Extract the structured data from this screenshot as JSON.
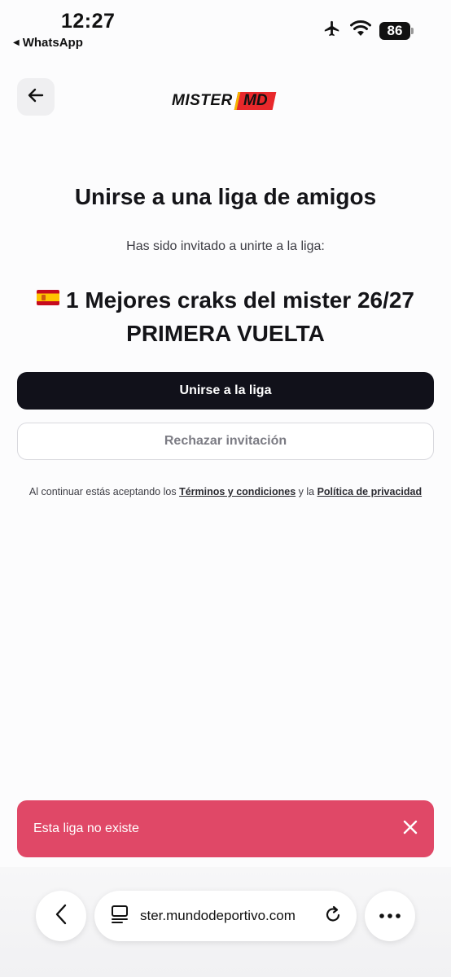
{
  "status_bar": {
    "time": "12:27",
    "back_app": "WhatsApp",
    "battery": "86"
  },
  "header": {
    "logo_text": "MISTER",
    "logo_badge": "MD"
  },
  "invite": {
    "title": "Unirse a una liga de amigos",
    "subtitle": "Has sido invitado a unirte a la liga:",
    "league_line1": "1 Mejores craks del mister 26/27",
    "league_line2": "PRIMERA VUELTA"
  },
  "actions": {
    "join_label": "Unirse a la liga",
    "reject_label": "Rechazar invitación"
  },
  "legal": {
    "prefix": "Al continuar estás aceptando los",
    "terms_link": "Términos y condiciones",
    "middle": "y la",
    "privacy_link": "Política de privacidad"
  },
  "toast": {
    "message": "Esta liga no existe"
  },
  "browser": {
    "url": "ster.mundodeportivo.com"
  },
  "colors": {
    "primary_button": "#11111a",
    "toast_bg": "#e04867"
  }
}
